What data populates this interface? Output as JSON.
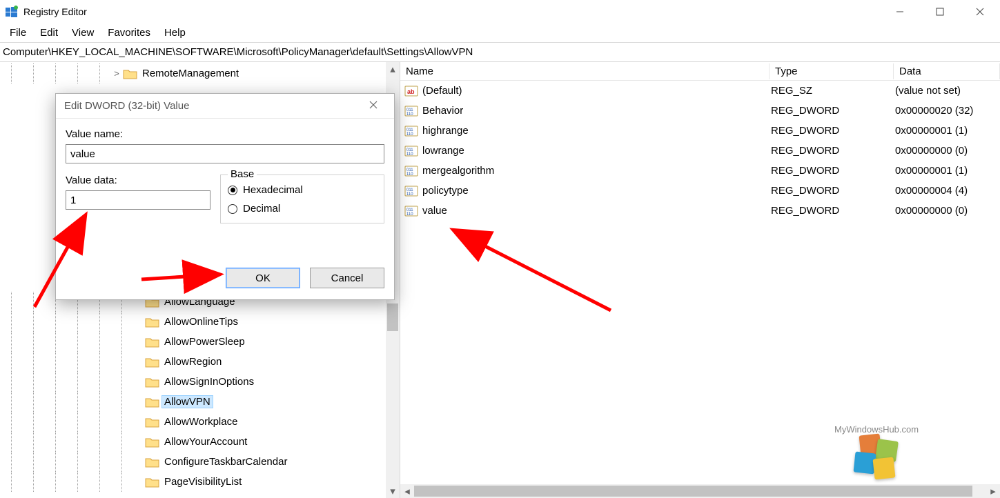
{
  "window": {
    "title": "Registry Editor"
  },
  "menu": {
    "file": "File",
    "edit": "Edit",
    "view": "View",
    "favorites": "Favorites",
    "help": "Help"
  },
  "address": "Computer\\HKEY_LOCAL_MACHINE\\SOFTWARE\\Microsoft\\PolicyManager\\default\\Settings\\AllowVPN",
  "tree": {
    "items": [
      {
        "label": "RemoteManagement",
        "expander": ">",
        "depth": 5
      },
      {
        "label": "AllowLanguage",
        "expander": "",
        "depth": 6
      },
      {
        "label": "AllowOnlineTips",
        "expander": "",
        "depth": 6
      },
      {
        "label": "AllowPowerSleep",
        "expander": "",
        "depth": 6
      },
      {
        "label": "AllowRegion",
        "expander": "",
        "depth": 6
      },
      {
        "label": "AllowSignInOptions",
        "expander": "",
        "depth": 6
      },
      {
        "label": "AllowVPN",
        "expander": "",
        "depth": 6,
        "selected": true
      },
      {
        "label": "AllowWorkplace",
        "expander": "",
        "depth": 6
      },
      {
        "label": "AllowYourAccount",
        "expander": "",
        "depth": 6
      },
      {
        "label": "ConfigureTaskbarCalendar",
        "expander": "",
        "depth": 6
      },
      {
        "label": "PageVisibilityList",
        "expander": "",
        "depth": 6
      }
    ]
  },
  "columns": {
    "name": "Name",
    "type": "Type",
    "data": "Data"
  },
  "values": [
    {
      "icon": "str",
      "name": "(Default)",
      "type": "REG_SZ",
      "data": "(value not set)"
    },
    {
      "icon": "bin",
      "name": "Behavior",
      "type": "REG_DWORD",
      "data": "0x00000020 (32)"
    },
    {
      "icon": "bin",
      "name": "highrange",
      "type": "REG_DWORD",
      "data": "0x00000001 (1)"
    },
    {
      "icon": "bin",
      "name": "lowrange",
      "type": "REG_DWORD",
      "data": "0x00000000 (0)"
    },
    {
      "icon": "bin",
      "name": "mergealgorithm",
      "type": "REG_DWORD",
      "data": "0x00000001 (1)"
    },
    {
      "icon": "bin",
      "name": "policytype",
      "type": "REG_DWORD",
      "data": "0x00000004 (4)"
    },
    {
      "icon": "bin",
      "name": "value",
      "type": "REG_DWORD",
      "data": "0x00000000 (0)"
    }
  ],
  "dialog": {
    "title": "Edit DWORD (32-bit) Value",
    "value_name_label": "Value name:",
    "value_name": "value",
    "value_data_label": "Value data:",
    "value_data": "1",
    "base_label": "Base",
    "hex_label": "Hexadecimal",
    "dec_label": "Decimal",
    "ok": "OK",
    "cancel": "Cancel"
  },
  "watermark": "MyWindowsHub.com"
}
